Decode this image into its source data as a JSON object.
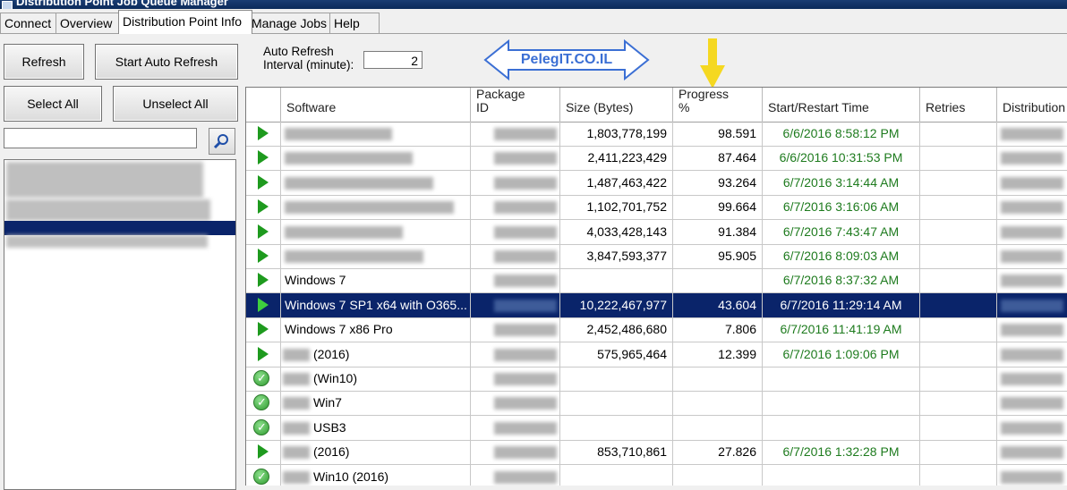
{
  "window": {
    "title": "Distribution Point Job Queue Manager"
  },
  "tabs": [
    "Connect",
    "Overview",
    "Distribution Point Info",
    "Manage Jobs",
    "Help"
  ],
  "toolbar": {
    "refresh_label": "Refresh",
    "auto_refresh_label": "Start Auto Refresh",
    "interval_label_1": "Auto Refresh",
    "interval_label_2": "Interval (minute):",
    "interval_value": "2",
    "select_all_label": "Select All",
    "unselect_all_label": "Unselect All"
  },
  "watermark": {
    "text": "PelegIT.CO.IL"
  },
  "grid": {
    "columns": [
      "Software",
      "Package\nID",
      "Size (Bytes)",
      "Progress\n%",
      "Start/Restart Time",
      "Retries",
      "Distribution P"
    ],
    "rows": [
      {
        "icon": "play",
        "software": "",
        "size": "1,803,778,199",
        "progress": "98.591",
        "time": "6/6/2016 8:58:12 PM"
      },
      {
        "icon": "play",
        "software": "",
        "size": "2,411,223,429",
        "progress": "87.464",
        "time": "6/6/2016 10:31:53 PM"
      },
      {
        "icon": "play",
        "software": "",
        "size": "1,487,463,422",
        "progress": "93.264",
        "time": "6/7/2016 3:14:44 AM"
      },
      {
        "icon": "play",
        "software": "",
        "size": "1,102,701,752",
        "progress": "99.664",
        "time": "6/7/2016 3:16:06 AM"
      },
      {
        "icon": "play",
        "software": "",
        "size": "4,033,428,143",
        "progress": "91.384",
        "time": "6/7/2016 7:43:47 AM"
      },
      {
        "icon": "play",
        "software": "",
        "size": "3,847,593,377",
        "progress": "95.905",
        "time": "6/7/2016 8:09:03 AM"
      },
      {
        "icon": "play",
        "software": "Windows 7",
        "size": "",
        "progress": "",
        "time": "6/7/2016 8:37:32 AM"
      },
      {
        "icon": "play",
        "software": "Windows 7 SP1 x64 with O365...",
        "size": "10,222,467,977",
        "progress": "43.604",
        "time": "6/7/2016 11:29:14 AM",
        "selected": true
      },
      {
        "icon": "play",
        "software": "Windows 7 x86 Pro",
        "size": "2,452,486,680",
        "progress": "7.806",
        "time": "6/7/2016 11:41:19 AM"
      },
      {
        "icon": "play",
        "software": "(2016)",
        "size": "575,965,464",
        "progress": "12.399",
        "time": "6/7/2016 1:09:06 PM"
      },
      {
        "icon": "check",
        "software": "(Win10)",
        "size": "",
        "progress": "",
        "time": ""
      },
      {
        "icon": "check",
        "software": "Win7",
        "size": "",
        "progress": "",
        "time": ""
      },
      {
        "icon": "check",
        "software": "USB3",
        "size": "",
        "progress": "",
        "time": ""
      },
      {
        "icon": "play",
        "software": "(2016)",
        "size": "853,710,861",
        "progress": "27.826",
        "time": "6/7/2016 1:32:28 PM"
      },
      {
        "icon": "check",
        "software": "Win10 (2016)",
        "size": "",
        "progress": "",
        "time": ""
      }
    ]
  },
  "colors": {
    "selection": "#0a246a",
    "time_text": "#1e7b1e",
    "play_icon": "#1e9a1e",
    "watermark": "#3b6fd4",
    "arrow": "#f5d821"
  }
}
